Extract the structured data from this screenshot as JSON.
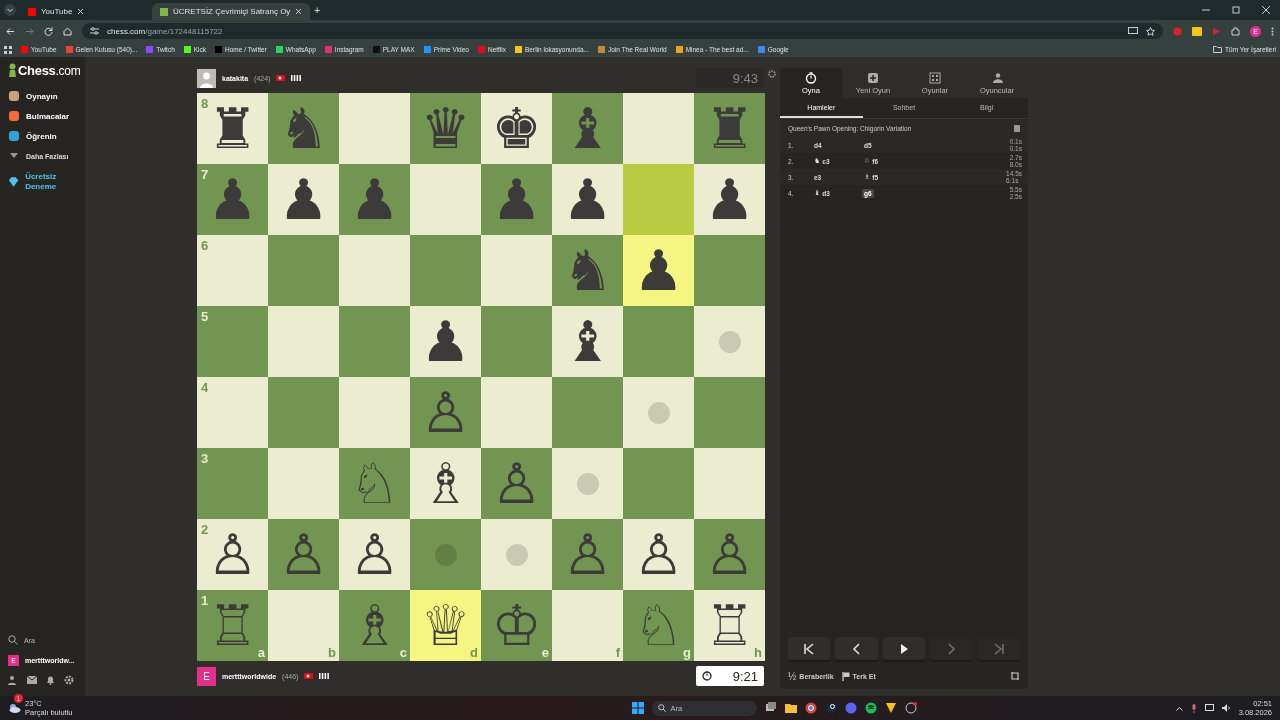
{
  "browser": {
    "tabs": [
      {
        "title": "YouTube",
        "selected": false,
        "color": "#ff0000"
      },
      {
        "title": "ÜCRETSİZ Çevrimiçi Satranç Oy",
        "selected": true,
        "color": "#81b64c"
      }
    ],
    "new_tab": "+",
    "url": {
      "host": "chess.com",
      "path": "/game/172448115722"
    },
    "bookmarks": [
      {
        "label": "YouTube",
        "color": "#ff0000"
      },
      {
        "label": "Gelen Kutusu (540)...",
        "color": "#ea4335"
      },
      {
        "label": "Twitch",
        "color": "#9146ff"
      },
      {
        "label": "Kick",
        "color": "#53fc18"
      },
      {
        "label": "Home / Twitter",
        "color": "#000000"
      },
      {
        "label": "WhatsApp",
        "color": "#25d366"
      },
      {
        "label": "Instagram",
        "color": "#e1306c"
      },
      {
        "label": "PLAY MAX",
        "color": "#111111"
      },
      {
        "label": "Prime Video",
        "color": "#1a98ff"
      },
      {
        "label": "Netflix",
        "color": "#e50914"
      },
      {
        "label": "Berlin lokasyonunda...",
        "color": "#f5c518"
      },
      {
        "label": "Join The Real World",
        "color": "#c08a3e"
      },
      {
        "label": "Minea - The best ad...",
        "color": "#f0a020"
      },
      {
        "label": "Google",
        "color": "#4285f4"
      }
    ],
    "all_bookmarks": "Tüm Yer İşaretleri",
    "profile_initial": "E"
  },
  "sidebar": {
    "logo": "**Chess**.com",
    "nav": [
      {
        "label": "Oynayın",
        "kind": "main",
        "color": "#c9a27e"
      },
      {
        "label": "Bulmacalar",
        "kind": "main",
        "color": "#f26b3a"
      },
      {
        "label": "Öğrenin",
        "kind": "main",
        "color": "#33a0d8"
      },
      {
        "label": "Daha Fazlası",
        "kind": "more",
        "color": "#9a9894"
      },
      {
        "label": "Ücretsiz Deneme",
        "kind": "promo",
        "color": "#52c3e8"
      }
    ],
    "search": "Ara",
    "user": {
      "initial": "E",
      "name": "mertttworldw..."
    }
  },
  "top_player": {
    "name": "katakita",
    "rating": "(424)",
    "clock": "9:43",
    "active": false
  },
  "board": {
    "rank_labels": [
      "8",
      "7",
      "6",
      "5",
      "4",
      "3",
      "2",
      "1"
    ],
    "file_labels": [
      "a",
      "b",
      "c",
      "d",
      "e",
      "f",
      "g",
      "h"
    ],
    "ranks": [
      {
        "squares": [
          {
            "piece": "♜",
            "highlighted": false,
            "move_hint": false
          },
          {
            "piece": "♞",
            "highlighted": false,
            "move_hint": false
          },
          {
            "highlighted": false,
            "move_hint": false
          },
          {
            "piece": "♛",
            "highlighted": false,
            "move_hint": false
          },
          {
            "piece": "♚",
            "highlighted": false,
            "move_hint": false
          },
          {
            "piece": "♝",
            "highlighted": false,
            "move_hint": false
          },
          {
            "highlighted": false,
            "move_hint": false
          },
          {
            "piece": "♜",
            "highlighted": false,
            "move_hint": false
          }
        ]
      },
      {
        "squares": [
          {
            "piece": "♟",
            "highlighted": false,
            "move_hint": false
          },
          {
            "piece": "♟",
            "highlighted": false,
            "move_hint": false
          },
          {
            "piece": "♟",
            "highlighted": false,
            "move_hint": false
          },
          {
            "highlighted": false,
            "move_hint": false
          },
          {
            "piece": "♟",
            "highlighted": false,
            "move_hint": false
          },
          {
            "piece": "♟",
            "highlighted": false,
            "move_hint": false
          },
          {
            "highlighted": true,
            "move_hint": false
          },
          {
            "piece": "♟",
            "highlighted": false,
            "move_hint": false
          }
        ]
      },
      {
        "squares": [
          {
            "highlighted": false,
            "move_hint": false
          },
          {
            "highlighted": false,
            "move_hint": false
          },
          {
            "highlighted": false,
            "move_hint": false
          },
          {
            "highlighted": false,
            "move_hint": false
          },
          {
            "highlighted": false,
            "move_hint": false
          },
          {
            "piece": "♞",
            "highlighted": false,
            "move_hint": false
          },
          {
            "piece": "♟",
            "highlighted": true,
            "move_hint": false
          },
          {
            "highlighted": false,
            "move_hint": false
          }
        ]
      },
      {
        "squares": [
          {
            "highlighted": false,
            "move_hint": false
          },
          {
            "highlighted": false,
            "move_hint": false
          },
          {
            "highlighted": false,
            "move_hint": false
          },
          {
            "piece": "♟",
            "highlighted": false,
            "move_hint": false
          },
          {
            "highlighted": false,
            "move_hint": false
          },
          {
            "piece": "♝",
            "highlighted": false,
            "move_hint": false
          },
          {
            "highlighted": false,
            "move_hint": false
          },
          {
            "highlighted": false,
            "move_hint": true
          }
        ]
      },
      {
        "squares": [
          {
            "highlighted": false,
            "move_hint": false
          },
          {
            "highlighted": false,
            "move_hint": false
          },
          {
            "highlighted": false,
            "move_hint": false
          },
          {
            "piece": "♙",
            "highlighted": false,
            "move_hint": false
          },
          {
            "highlighted": false,
            "move_hint": false
          },
          {
            "highlighted": false,
            "move_hint": false
          },
          {
            "highlighted": false,
            "move_hint": true
          },
          {
            "highlighted": false,
            "move_hint": false
          }
        ]
      },
      {
        "squares": [
          {
            "highlighted": false,
            "move_hint": false
          },
          {
            "highlighted": false,
            "move_hint": false
          },
          {
            "piece": "♘",
            "highlighted": false,
            "move_hint": false
          },
          {
            "piece": "♗",
            "highlighted": false,
            "move_hint": false
          },
          {
            "piece": "♙",
            "highlighted": false,
            "move_hint": false
          },
          {
            "highlighted": false,
            "move_hint": true
          },
          {
            "highlighted": false,
            "move_hint": false
          },
          {
            "highlighted": false,
            "move_hint": false
          }
        ]
      },
      {
        "squares": [
          {
            "piece": "♙",
            "highlighted": false,
            "move_hint": false
          },
          {
            "piece": "♙",
            "highlighted": false,
            "move_hint": false
          },
          {
            "piece": "♙",
            "highlighted": false,
            "move_hint": false
          },
          {
            "highlighted": false,
            "move_hint": true
          },
          {
            "highlighted": false,
            "move_hint": true
          },
          {
            "piece": "♙",
            "highlighted": false,
            "move_hint": false
          },
          {
            "piece": "♙",
            "highlighted": false,
            "move_hint": false
          },
          {
            "piece": "♙",
            "highlighted": false,
            "move_hint": false
          }
        ]
      },
      {
        "squares": [
          {
            "piece": "♖",
            "highlighted": false,
            "move_hint": false
          },
          {
            "highlighted": false,
            "move_hint": false
          },
          {
            "piece": "♗",
            "highlighted": false,
            "move_hint": false
          },
          {
            "piece": "♕",
            "highlighted": true,
            "move_hint": false
          },
          {
            "piece": "♔",
            "highlighted": false,
            "move_hint": false
          },
          {
            "highlighted": false,
            "move_hint": false
          },
          {
            "piece": "♘",
            "highlighted": false,
            "move_hint": false
          },
          {
            "piece": "♖",
            "highlighted": false,
            "move_hint": false
          }
        ]
      }
    ]
  },
  "bottom_player": {
    "initial": "E",
    "name": "mertttworldwide",
    "rating": "(446)",
    "clock": "9:21",
    "active": true
  },
  "panel": {
    "tabs": [
      {
        "label": "Oyna",
        "kind": "clock",
        "selected": true
      },
      {
        "label": "Yeni Oyun",
        "kind": "plus",
        "selected": false
      },
      {
        "label": "Oyunlar",
        "kind": "grid",
        "selected": false
      },
      {
        "label": "Oyuncular",
        "kind": "people",
        "selected": false
      }
    ],
    "subtabs": [
      {
        "label": "Hamleler",
        "selected": true
      },
      {
        "label": "Sohbet",
        "selected": false
      },
      {
        "label": "Bilgi",
        "selected": false
      }
    ],
    "opening": "Queen's Pawn Opening: Chigorin Variation",
    "moves": [
      {
        "number": "1.",
        "white": {
          "text": "d4",
          "selected": false
        },
        "black": {
          "text": "d5",
          "selected": false
        },
        "times": [
          "0.1s",
          "0.1s"
        ]
      },
      {
        "number": "2.",
        "white": {
          "figurine": "♞",
          "text": "c3",
          "selected": false
        },
        "black": {
          "figurine": "♘",
          "text": "f6",
          "selected": false
        },
        "times": [
          "2.7s",
          "8.0s"
        ]
      },
      {
        "number": "3.",
        "white": {
          "text": "e3",
          "selected": false
        },
        "black": {
          "figurine": "♗",
          "text": "f5",
          "selected": false
        },
        "times": [
          "14.5s",
          "6.1s"
        ]
      },
      {
        "number": "4.",
        "white": {
          "figurine": "♝",
          "text": "d3",
          "selected": false
        },
        "black": {
          "text": "g6",
          "selected": true
        },
        "times": [
          "5.5s",
          "2.5s"
        ]
      }
    ],
    "nav_buttons": [
      {
        "kind": "first",
        "disabled": false
      },
      {
        "kind": "prev",
        "disabled": false
      },
      {
        "kind": "play",
        "disabled": false
      },
      {
        "kind": "next",
        "disabled": true
      },
      {
        "kind": "last",
        "disabled": true
      }
    ],
    "draw": {
      "symbol": "½",
      "label": "Beraberlik"
    },
    "resign": "Terk Et"
  },
  "taskbar": {
    "weather": {
      "temp": "23°C",
      "text": "Parçalı bulutlu",
      "badge": "1"
    },
    "search": "Ara",
    "time": "02:51",
    "date": "3.08.2026"
  }
}
